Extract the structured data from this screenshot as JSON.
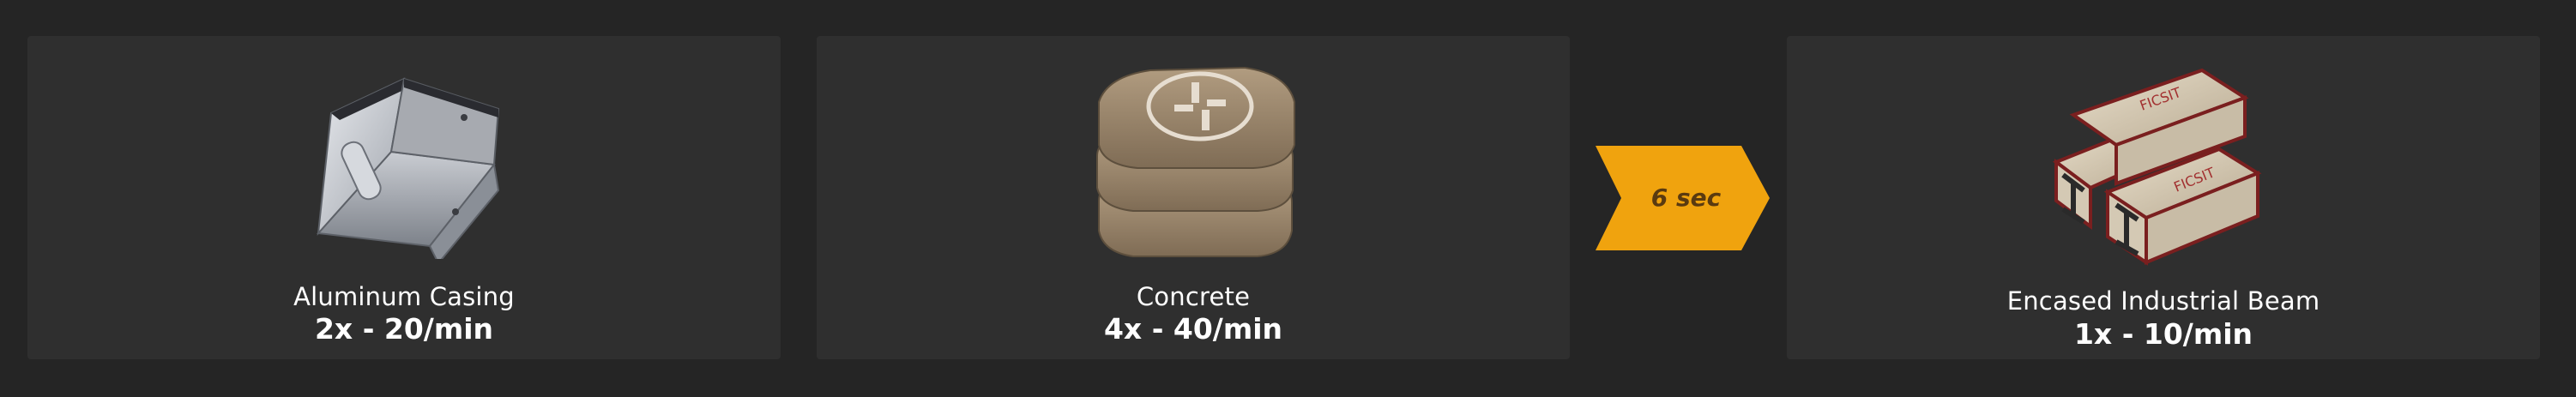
{
  "recipe": {
    "inputs": [
      {
        "name": "Aluminum Casing",
        "rate": "2x - 20/min",
        "icon": "aluminum-casing-icon"
      },
      {
        "name": "Concrete",
        "rate": "4x - 40/min",
        "icon": "concrete-icon"
      }
    ],
    "duration": "6 sec",
    "output": {
      "name": "Encased Industrial Beam",
      "rate": "1x - 10/min",
      "icon": "encased-industrial-beam-icon"
    }
  },
  "colors": {
    "background": "#252525",
    "card": "#2f2f2f",
    "arrow": "#f0a30e",
    "arrow_text": "#5a3a10",
    "text": "#ffffff"
  }
}
